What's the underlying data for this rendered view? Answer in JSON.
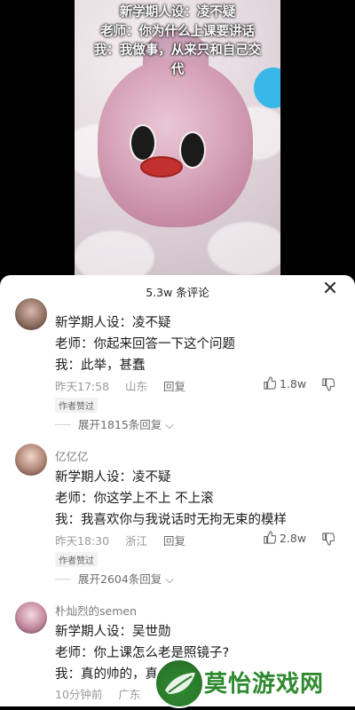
{
  "video": {
    "overlay_lines": [
      "新学期人设：凌不疑",
      "老师：你为什么上课要讲话",
      "我：我做事，从来只和自己交",
      "代"
    ]
  },
  "sheet": {
    "comment_count": "5.3w 条评论"
  },
  "comments": [
    {
      "username": "",
      "lines": [
        "新学期人设：凌不疑",
        "老师：你起来回答一下这个问题",
        "我：此举，甚蠢"
      ],
      "time": "昨天17:58",
      "location": "山东",
      "reply_label": "回复",
      "likes": "1.8w",
      "author_badge": "作者赞过",
      "expand": "展开1815条回复"
    },
    {
      "username": "亿亿亿",
      "lines": [
        "新学期人设：凌不疑",
        "老师：你这学上不上 不上滚",
        "我：我喜欢你与我说话时无拘无束的模样"
      ],
      "time": "昨天18:30",
      "location": "浙江",
      "reply_label": "回复",
      "likes": "2.8w",
      "author_badge": "作者赞过",
      "expand": "展开2604条回复"
    },
    {
      "username": "朴灿烈的semen",
      "lines": [
        "新学期人设：吴世勋",
        "老师：你上课怎么老是照镜子?",
        "我：真的帅的，真"
      ],
      "time": "10分钟前",
      "location": "广东"
    }
  ],
  "watermark": {
    "text": "莫怡游戏网"
  },
  "colors": {
    "accent_green": "#2f8a2f",
    "blue_blob": "#38b7e8"
  }
}
